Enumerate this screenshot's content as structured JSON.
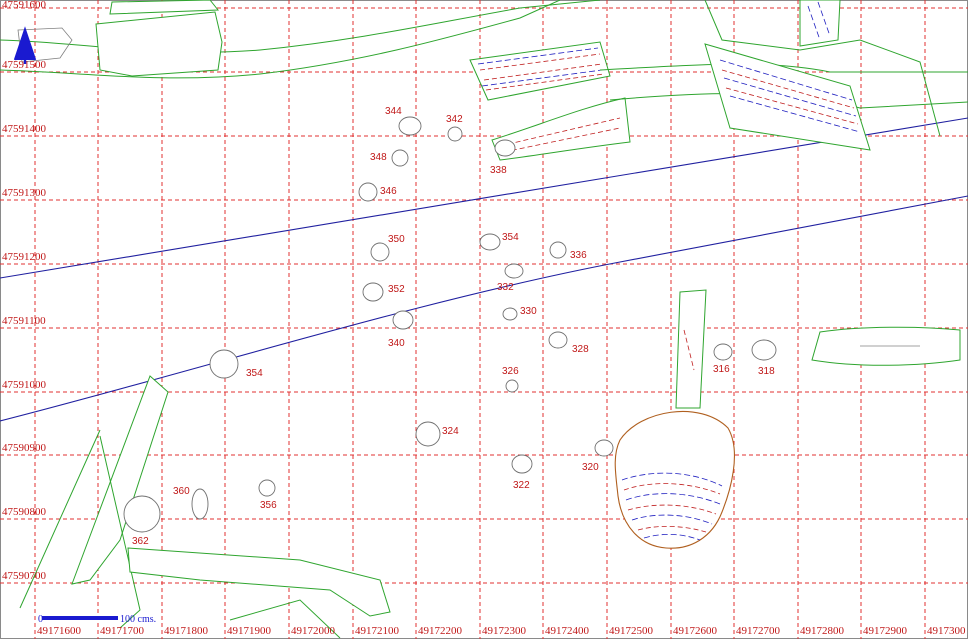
{
  "map": {
    "y_labels": [
      "47591600",
      "47591500",
      "47591400",
      "47591300",
      "47591200",
      "47591100",
      "47591000",
      "47590900",
      "47590800",
      "47590700"
    ],
    "x_labels": [
      "49171600",
      "49171700",
      "49171800",
      "49171900",
      "49172000",
      "49172100",
      "49172200",
      "49172300",
      "49172400",
      "49172500",
      "49172600",
      "49172700",
      "49172800",
      "49172900",
      "4917300"
    ],
    "features": [
      "344",
      "342",
      "348",
      "338",
      "346",
      "350",
      "354",
      "336",
      "332",
      "352",
      "330",
      "340",
      "328",
      "316",
      "318",
      "354",
      "326",
      "324",
      "320",
      "322",
      "360",
      "356",
      "362"
    ],
    "scale": {
      "start": "0",
      "end": "100 cms."
    },
    "colors": {
      "grid": "#e03030",
      "label": "#c01818",
      "outline": "#2fa52f",
      "line": "#2020a0",
      "pit": "#707070",
      "cut": "#b06020"
    }
  }
}
